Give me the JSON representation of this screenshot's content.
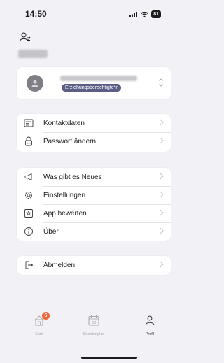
{
  "status_bar": {
    "time": "14:50",
    "battery": "81"
  },
  "account": {
    "name": "Dieter",
    "role": "Erziehungsberechtigte*r"
  },
  "group_contact": [
    {
      "label": "Kontaktdaten",
      "icon": "contact-card-icon"
    },
    {
      "label": "Passwort ändern",
      "icon": "lock-icon"
    }
  ],
  "group_app": [
    {
      "label": "Was gibt es Neues",
      "icon": "megaphone-icon"
    },
    {
      "label": "Einstellungen",
      "icon": "gear-icon"
    },
    {
      "label": "App bewerten",
      "icon": "star-icon"
    },
    {
      "label": "Über",
      "icon": "info-icon"
    }
  ],
  "group_logout": [
    {
      "label": "Abmelden",
      "icon": "logout-icon"
    }
  ],
  "tabs": {
    "start": {
      "label": "Start",
      "badge": "6"
    },
    "plan": {
      "label": "Stundenplan",
      "day": "30"
    },
    "profile": {
      "label": "Profil"
    }
  },
  "colors": {
    "accent_badge": "#f0643a",
    "role_badge": "#5b5f86",
    "background": "#f2f2f6"
  }
}
